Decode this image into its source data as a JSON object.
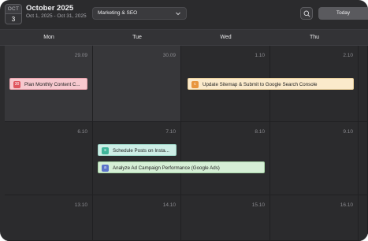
{
  "header": {
    "badge_month": "OCT",
    "badge_day": "3",
    "title": "October 2025",
    "subtitle": "Oct 1, 2025 - Oct 31, 2025",
    "calendar_select": "Marketing & SEO",
    "today_label": "Today"
  },
  "days": [
    "Mon",
    "Tue",
    "Wed",
    "Thu"
  ],
  "weeks": [
    [
      "29.09",
      "30.09",
      "1.10",
      "2.10"
    ],
    [
      "6.10",
      "7.10",
      "8.10",
      "9.10"
    ],
    [
      "13.10",
      "14.10",
      "15.10",
      "16.10"
    ]
  ],
  "events": [
    {
      "title": "Plan Monthly Content C...",
      "icon": "30",
      "color": "#f7c9cf",
      "icon_color": "#e0555f"
    },
    {
      "title": "Update Sitemap & Submit to Google Search Console",
      "icon": "c",
      "color": "#fbeacb",
      "icon_color": "#e8953c"
    },
    {
      "title": "Schedule Posts on Insta...",
      "icon": "s",
      "color": "#cdeee6",
      "icon_color": "#3fb59a"
    },
    {
      "title": "Analyze Ad Campaign Performance (Google Ads)",
      "icon": "a",
      "color": "#d6efd6",
      "icon_color": "#5b73c9"
    }
  ]
}
